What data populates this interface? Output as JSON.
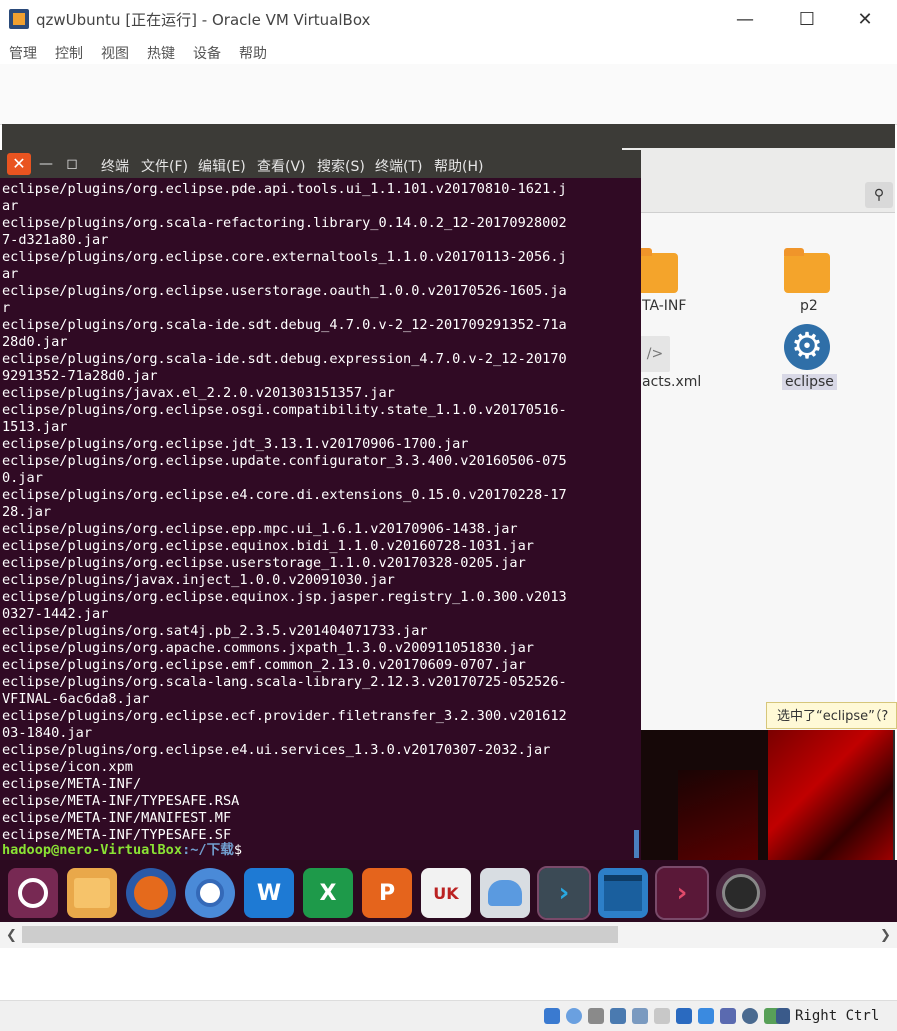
{
  "window": {
    "title": "qzwUbuntu [正在运行] - Oracle VM VirtualBox",
    "minimize_icon": "minimize-icon",
    "maximize_icon": "maximize-icon",
    "close_icon": "close-icon"
  },
  "vbox_menu": [
    "管理",
    "控制",
    "视图",
    "热键",
    "设备",
    "帮助"
  ],
  "terminal": {
    "menu": [
      "终端",
      "文件(F)",
      "编辑(E)",
      "查看(V)",
      "搜索(S)",
      "终端(T)",
      "帮助(H)"
    ],
    "lines": [
      "eclipse/plugins/org.eclipse.pde.api.tools.ui_1.1.101.v20170810-1621.j",
      "ar",
      "eclipse/plugins/org.scala-refactoring.library_0.14.0.2_12-20170928002",
      "7-d321a80.jar",
      "eclipse/plugins/org.eclipse.core.externaltools_1.1.0.v20170113-2056.j",
      "ar",
      "eclipse/plugins/org.eclipse.userstorage.oauth_1.0.0.v20170526-1605.ja",
      "r",
      "eclipse/plugins/org.scala-ide.sdt.debug_4.7.0.v-2_12-201709291352-71a",
      "28d0.jar",
      "eclipse/plugins/org.scala-ide.sdt.debug.expression_4.7.0.v-2_12-20170",
      "9291352-71a28d0.jar",
      "eclipse/plugins/javax.el_2.2.0.v201303151357.jar",
      "eclipse/plugins/org.eclipse.osgi.compatibility.state_1.1.0.v20170516-",
      "1513.jar",
      "eclipse/plugins/org.eclipse.jdt_3.13.1.v20170906-1700.jar",
      "eclipse/plugins/org.eclipse.update.configurator_3.3.400.v20160506-075",
      "0.jar",
      "eclipse/plugins/org.eclipse.e4.core.di.extensions_0.15.0.v20170228-17",
      "28.jar",
      "eclipse/plugins/org.eclipse.epp.mpc.ui_1.6.1.v20170906-1438.jar",
      "eclipse/plugins/org.eclipse.equinox.bidi_1.1.0.v20160728-1031.jar",
      "eclipse/plugins/org.eclipse.userstorage_1.1.0.v20170328-0205.jar",
      "eclipse/plugins/javax.inject_1.0.0.v20091030.jar",
      "eclipse/plugins/org.eclipse.equinox.jsp.jasper.registry_1.0.300.v2013",
      "0327-1442.jar",
      "eclipse/plugins/org.sat4j.pb_2.3.5.v201404071733.jar",
      "eclipse/plugins/org.apache.commons.jxpath_1.3.0.v200911051830.jar",
      "eclipse/plugins/org.eclipse.emf.common_2.13.0.v20170609-0707.jar",
      "eclipse/plugins/org.scala-lang.scala-library_2.12.3.v20170725-052526-",
      "VFINAL-6ac6da8.jar",
      "eclipse/plugins/org.eclipse.ecf.provider.filetransfer_3.2.300.v201612",
      "03-1840.jar",
      "eclipse/plugins/org.eclipse.e4.ui.services_1.3.0.v20170307-2032.jar",
      "eclipse/icon.xpm",
      "eclipse/META-INF/",
      "eclipse/META-INF/TYPESAFE.RSA",
      "eclipse/META-INF/MANIFEST.MF",
      "eclipse/META-INF/TYPESAFE.SF"
    ],
    "prompt_user": "hadoop@nero-VirtualBox",
    "prompt_path": ":~/下载",
    "prompt_symbol": "$"
  },
  "file_manager": {
    "items": [
      {
        "label": "TA-INF",
        "icon": "folder-icon"
      },
      {
        "label": "p2",
        "icon": "folder-icon"
      },
      {
        "label": "acts.xml",
        "icon": "xml-file-icon"
      },
      {
        "label": "eclipse",
        "icon": "gear-icon"
      }
    ],
    "status_tip": "选中了“eclipse”（?"
  },
  "dock": {
    "icons": [
      "ubuntu-logo-icon",
      "files-icon",
      "firefox-icon",
      "chromium-icon",
      "wps-writer-icon",
      "wps-spreadsheets-icon",
      "wps-presentation-icon",
      "ubuntu-store-icon",
      "installer-icon",
      "terminal-icon",
      "app-switcher-icon",
      "terminal-icon-2",
      "disk-icon"
    ]
  },
  "statusbar": {
    "host_key": "Right Ctrl"
  }
}
